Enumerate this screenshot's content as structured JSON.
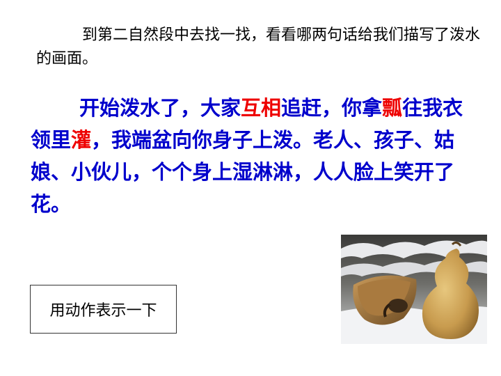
{
  "instruction": {
    "text": "到第二自然段中去找一找，看看哪两句话给我们描写了泼水的画面。"
  },
  "passage": {
    "seg1": "开始泼水了，大家",
    "highlight1": "互相",
    "seg2": "追赶，你拿",
    "highlight2_top": "瓢",
    "seg3": "往我衣领里",
    "highlight3": "灌",
    "seg4": "，我端盆向你身子上泼。老人、孩子、姑娘、小伙儿，个个身上湿淋淋，人人脸上笑开了花。"
  },
  "action_box": {
    "label": "用动作表示一下"
  },
  "colors": {
    "passage_text": "#0000CC",
    "highlight": "#EE0000",
    "instruction_text": "#000000"
  }
}
